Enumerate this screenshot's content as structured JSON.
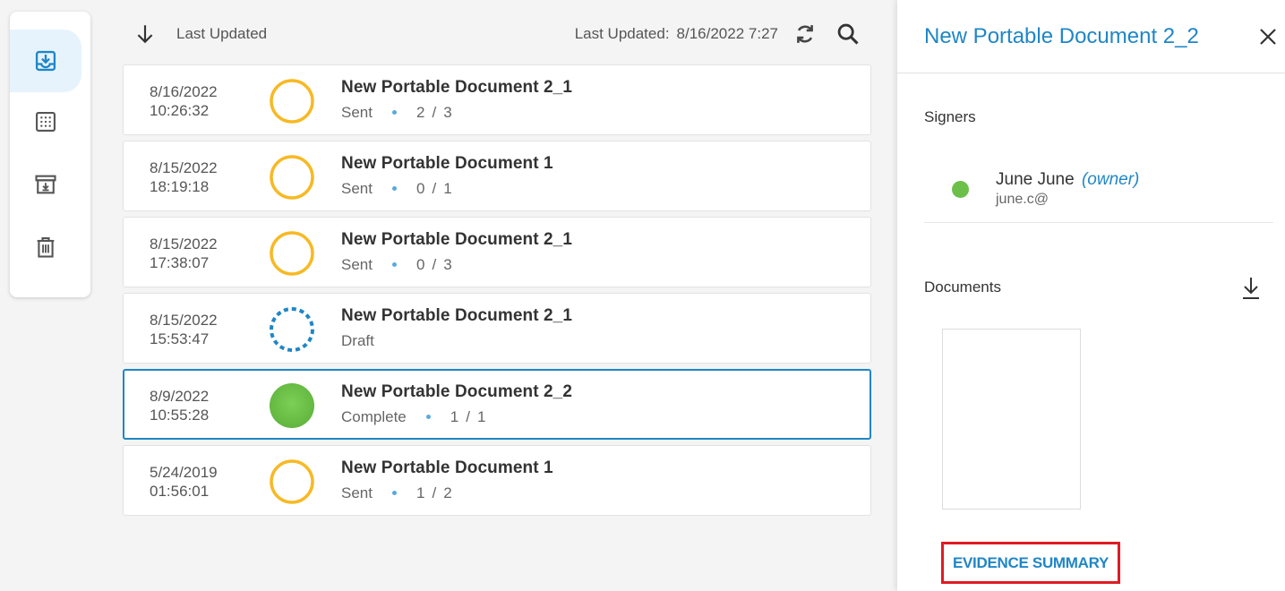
{
  "rail": {
    "items": [
      {
        "name": "inbox",
        "icon": "inbox-download-icon",
        "active": true
      },
      {
        "name": "templates",
        "icon": "grid-dots-icon",
        "active": false
      },
      {
        "name": "archive",
        "icon": "archive-box-icon",
        "active": false
      },
      {
        "name": "trash",
        "icon": "trash-icon",
        "active": false
      }
    ]
  },
  "toolbar": {
    "sort_label": "Last Updated",
    "updated_label": "Last Updated:",
    "updated_value": "8/16/2022 7:27"
  },
  "documents": [
    {
      "date": "8/16/2022",
      "time": "10:26:32",
      "title": "New Portable Document 2_1",
      "status": "Sent",
      "signed": "2",
      "total": "3",
      "state": "sent"
    },
    {
      "date": "8/15/2022",
      "time": "18:19:18",
      "title": "New Portable Document 1",
      "status": "Sent",
      "signed": "0",
      "total": "1",
      "state": "sent"
    },
    {
      "date": "8/15/2022",
      "time": "17:38:07",
      "title": "New Portable Document 2_1",
      "status": "Sent",
      "signed": "0",
      "total": "3",
      "state": "sent"
    },
    {
      "date": "8/15/2022",
      "time": "15:53:47",
      "title": "New Portable Document 2_1",
      "status": "Draft",
      "signed": null,
      "total": null,
      "state": "draft"
    },
    {
      "date": "8/9/2022",
      "time": "10:55:28",
      "title": "New Portable Document 2_2",
      "status": "Complete",
      "signed": "1",
      "total": "1",
      "state": "complete",
      "selected": true
    },
    {
      "date": "5/24/2019",
      "time": "01:56:01",
      "title": "New Portable Document 1",
      "status": "Sent",
      "signed": "1",
      "total": "2",
      "state": "sent"
    }
  ],
  "panel": {
    "title": "New Portable Document 2_2",
    "signers_heading": "Signers",
    "signer": {
      "name": "June June",
      "role": "(owner)",
      "email": "june.c@"
    },
    "documents_heading": "Documents",
    "evidence_button": "EVIDENCE SUMMARY"
  },
  "colors": {
    "accent": "#1f86c6",
    "sent": "#f7b924",
    "complete": "#6cc04a",
    "highlight": "#e01b24"
  }
}
